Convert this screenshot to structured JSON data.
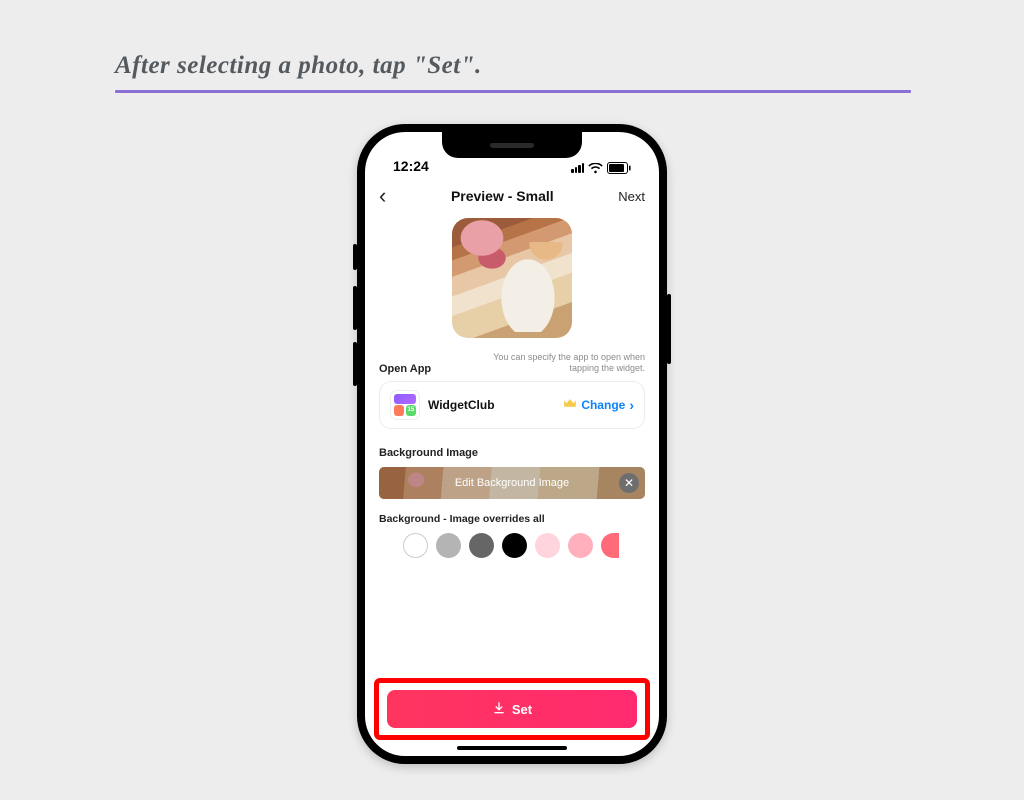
{
  "instruction": "After selecting a photo, tap \"Set\".",
  "status": {
    "time": "12:24"
  },
  "nav": {
    "title": "Preview - Small",
    "next": "Next"
  },
  "open_app": {
    "label": "Open App",
    "help": "You can specify the app to open when tapping the widget.",
    "app_name": "WidgetClub",
    "change": "Change"
  },
  "background": {
    "label": "Background Image",
    "edit_label": "Edit Background Image",
    "sub": "Background - Image overrides all",
    "swatches": [
      "#ffffff",
      "#b4b4b4",
      "#666666",
      "#000000",
      "#ffd4dc",
      "#ffb0bc",
      "#ff6b78"
    ]
  },
  "set": {
    "label": "Set"
  }
}
